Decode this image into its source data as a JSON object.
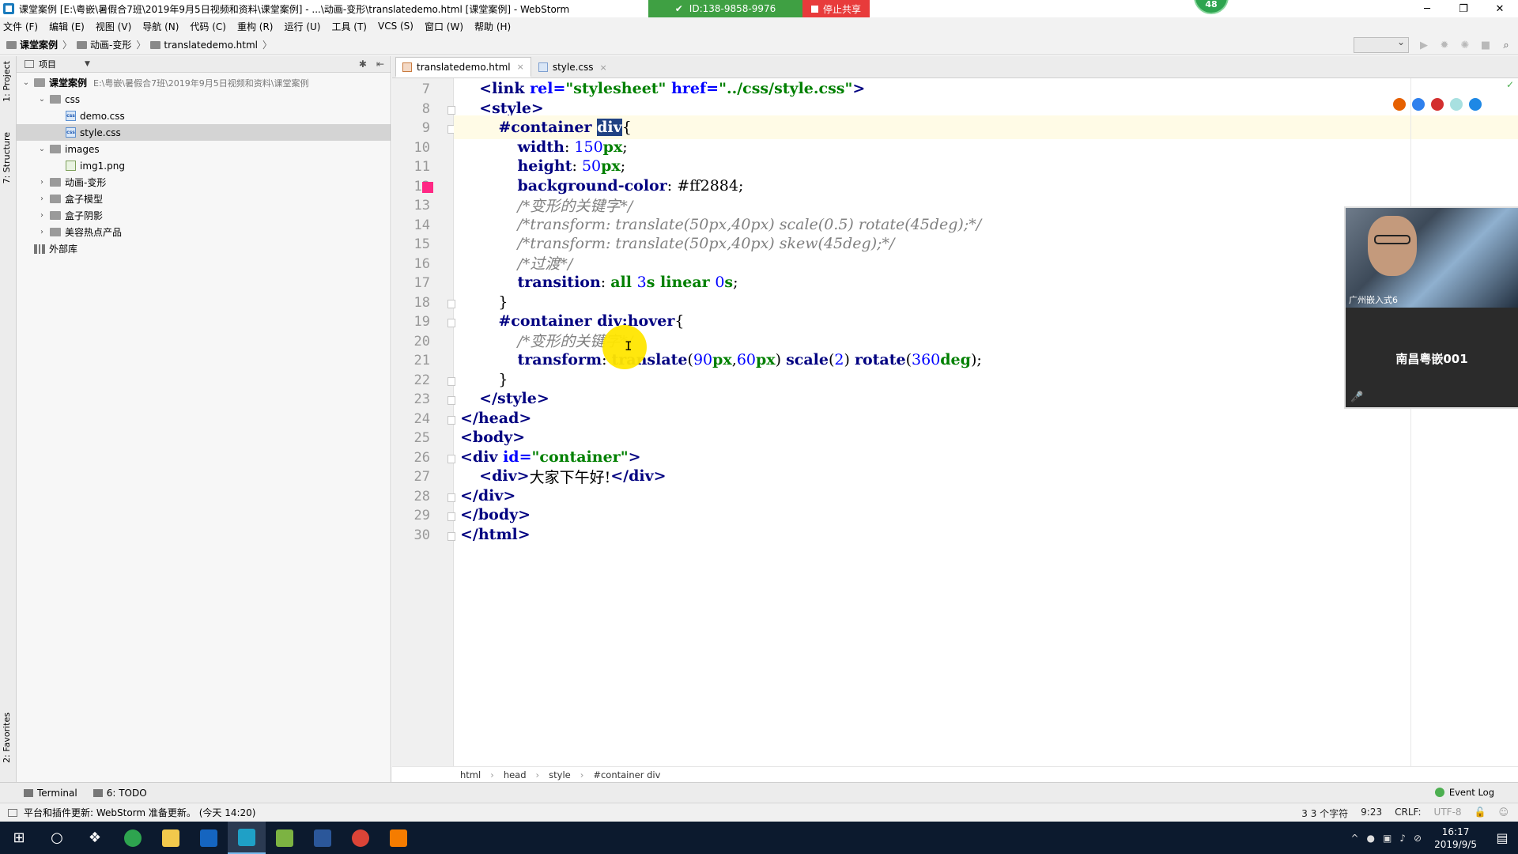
{
  "window": {
    "title": "课堂案例 [E:\\粤嵌\\暑假合7班\\2019年9月5日视频和资料\\课堂案例] - ...\\动画-变形\\translatedemo.html [课堂案例] - WebStorm",
    "controls": {
      "minimize": "─",
      "restore": "❐",
      "close": "✕"
    }
  },
  "share": {
    "id_text": "ID:138-9858-9976",
    "stop_text": "停止共享",
    "badge": "48"
  },
  "menu": [
    "文件 (F)",
    "编辑 (E)",
    "视图 (V)",
    "导航 (N)",
    "代码 (C)",
    "重构 (R)",
    "运行 (U)",
    "工具 (T)",
    "VCS (S)",
    "窗口 (W)",
    "帮助 (H)"
  ],
  "breadcrumb": [
    "课堂案例",
    "动画-变形",
    "translatedemo.html"
  ],
  "left_strip": {
    "project_tab": "1: Project",
    "structure_tab": "7: Structure",
    "favorites_tab": "2: Favorites"
  },
  "project_panel": {
    "header": "项目",
    "tree": [
      {
        "label": "课堂案例",
        "path": "E:\\粤嵌\\暑假合7班\\2019年9月5日视频和资料\\课堂案例",
        "type": "folder",
        "depth": 0,
        "expanded": true,
        "bold": true
      },
      {
        "label": "css",
        "type": "folder",
        "depth": 1,
        "expanded": true
      },
      {
        "label": "demo.css",
        "type": "css",
        "depth": 2
      },
      {
        "label": "style.css",
        "type": "css",
        "depth": 2,
        "selected": true
      },
      {
        "label": "images",
        "type": "folder",
        "depth": 1,
        "expanded": true
      },
      {
        "label": "img1.png",
        "type": "img",
        "depth": 2
      },
      {
        "label": "动画-变形",
        "type": "folder",
        "depth": 1,
        "expanded": false
      },
      {
        "label": "盒子模型",
        "type": "folder",
        "depth": 1,
        "expanded": false
      },
      {
        "label": "盒子阴影",
        "type": "folder",
        "depth": 1,
        "expanded": false
      },
      {
        "label": "美容热点产品",
        "type": "folder",
        "depth": 1,
        "expanded": false
      },
      {
        "label": "外部库",
        "type": "lib",
        "depth": 0
      }
    ]
  },
  "tabs": [
    {
      "label": "translatedemo.html",
      "active": true,
      "kind": "html"
    },
    {
      "label": "style.css",
      "active": false,
      "kind": "css"
    }
  ],
  "code_lines": [
    {
      "n": "7",
      "tokens": [
        [
          "    ",
          "tx"
        ],
        [
          "<link ",
          "tg"
        ],
        [
          "rel=",
          "an"
        ],
        [
          "\"stylesheet\"",
          "av"
        ],
        [
          " href=",
          "an"
        ],
        [
          "\"../css/style.css\"",
          "av"
        ],
        [
          ">",
          "tg"
        ]
      ]
    },
    {
      "n": "8",
      "tokens": [
        [
          "    ",
          "tx"
        ],
        [
          "<style>",
          "tg"
        ]
      ]
    },
    {
      "n": "9",
      "tokens": [
        [
          "        ",
          "tx"
        ],
        [
          "#container ",
          "sel"
        ],
        [
          "div",
          "hl-sel"
        ],
        [
          "{",
          "br"
        ]
      ],
      "current": true
    },
    {
      "n": "10",
      "tokens": [
        [
          "            ",
          "tx"
        ],
        [
          "width",
          "pn"
        ],
        [
          ": ",
          "tx"
        ],
        [
          "150",
          "num"
        ],
        [
          "px",
          "kw"
        ],
        [
          ";",
          "tx"
        ]
      ]
    },
    {
      "n": "11",
      "tokens": [
        [
          "            ",
          "tx"
        ],
        [
          "height",
          "pn"
        ],
        [
          ": ",
          "tx"
        ],
        [
          "50",
          "num"
        ],
        [
          "px",
          "kw"
        ],
        [
          ";",
          "tx"
        ]
      ]
    },
    {
      "n": "12",
      "tokens": [
        [
          "            ",
          "tx"
        ],
        [
          "background-color",
          "pn"
        ],
        [
          ": ",
          "tx"
        ],
        [
          "#ff2884",
          "tx"
        ],
        [
          ";",
          "tx"
        ]
      ],
      "swatch": true
    },
    {
      "n": "13",
      "tokens": [
        [
          "            ",
          "tx"
        ],
        [
          "/*变形的关键字*/",
          "cm"
        ]
      ]
    },
    {
      "n": "14",
      "tokens": [
        [
          "            ",
          "tx"
        ],
        [
          "/*transform: translate(50px,40px) scale(0.5) rotate(45deg);*/",
          "cm"
        ]
      ]
    },
    {
      "n": "15",
      "tokens": [
        [
          "            ",
          "tx"
        ],
        [
          "/*transform: translate(50px,40px) skew(45deg);*/",
          "cm"
        ]
      ]
    },
    {
      "n": "16",
      "tokens": [
        [
          "            ",
          "tx"
        ],
        [
          "/*过渡*/",
          "cm"
        ]
      ]
    },
    {
      "n": "17",
      "tokens": [
        [
          "            ",
          "tx"
        ],
        [
          "transition",
          "pn"
        ],
        [
          ": ",
          "tx"
        ],
        [
          "all ",
          "kw"
        ],
        [
          "3",
          "num"
        ],
        [
          "s ",
          "kw"
        ],
        [
          "linear ",
          "kw"
        ],
        [
          "0",
          "num"
        ],
        [
          "s",
          "kw"
        ],
        [
          ";",
          "tx"
        ]
      ]
    },
    {
      "n": "18",
      "tokens": [
        [
          "        ",
          "tx"
        ],
        [
          "}",
          "br"
        ]
      ]
    },
    {
      "n": "19",
      "tokens": [
        [
          "        ",
          "tx"
        ],
        [
          "#container div",
          "sel"
        ],
        [
          ":hover",
          "sel"
        ],
        [
          "{",
          "br"
        ]
      ]
    },
    {
      "n": "20",
      "tokens": [
        [
          "            ",
          "tx"
        ],
        [
          "/*变形的关键字*/",
          "cm"
        ]
      ]
    },
    {
      "n": "21",
      "tokens": [
        [
          "            ",
          "tx"
        ],
        [
          "transform",
          "pn"
        ],
        [
          ": ",
          "tx"
        ],
        [
          "translate",
          "pn"
        ],
        [
          "(",
          "tx"
        ],
        [
          "90",
          "num"
        ],
        [
          "px",
          "kw"
        ],
        [
          ",",
          "tx"
        ],
        [
          "60",
          "num"
        ],
        [
          "px",
          "kw"
        ],
        [
          ") ",
          "tx"
        ],
        [
          "scale",
          "pn"
        ],
        [
          "(",
          "tx"
        ],
        [
          "2",
          "num"
        ],
        [
          ") ",
          "tx"
        ],
        [
          "rotate",
          "pn"
        ],
        [
          "(",
          "tx"
        ],
        [
          "360",
          "num"
        ],
        [
          "deg",
          "kw"
        ],
        [
          ");",
          "tx"
        ]
      ]
    },
    {
      "n": "22",
      "tokens": [
        [
          "        ",
          "tx"
        ],
        [
          "}",
          "br"
        ]
      ]
    },
    {
      "n": "23",
      "tokens": [
        [
          "    ",
          "tx"
        ],
        [
          "</style>",
          "tg"
        ]
      ]
    },
    {
      "n": "24",
      "tokens": [
        [
          "</head>",
          "tg"
        ]
      ]
    },
    {
      "n": "25",
      "tokens": [
        [
          "<body>",
          "tg"
        ]
      ]
    },
    {
      "n": "26",
      "tokens": [
        [
          "<div ",
          "tg"
        ],
        [
          "id=",
          "an"
        ],
        [
          "\"container\"",
          "av"
        ],
        [
          ">",
          "tg"
        ]
      ]
    },
    {
      "n": "27",
      "tokens": [
        [
          "    ",
          "tx"
        ],
        [
          "<div>",
          "tg"
        ],
        [
          "大家下午好!",
          "tx"
        ],
        [
          "</div>",
          "tg"
        ]
      ]
    },
    {
      "n": "28",
      "tokens": [
        [
          "</div>",
          "tg"
        ]
      ]
    },
    {
      "n": "29",
      "tokens": [
        [
          "</body>",
          "tg"
        ]
      ]
    },
    {
      "n": "30",
      "tokens": [
        [
          "</html>",
          "tg"
        ]
      ]
    }
  ],
  "webcam": {
    "caption": "广州嵌入式6",
    "presenter": "南昌粤嵌001"
  },
  "path_bar": [
    "html",
    "head",
    "style",
    "#container div"
  ],
  "bottom_tools": {
    "terminal": "Terminal",
    "todo": "6: TODO",
    "event_log": "Event Log"
  },
  "status": {
    "message": "平台和插件更新: WebStorm 准备更新。 (今天 14:20)",
    "chars": "3 3 个字符",
    "position": "9:23",
    "line_sep": "CRLF:",
    "encoding": "UTF-8"
  },
  "taskbar": {
    "time": "16:17",
    "date": "2019/9/5"
  },
  "colors": {
    "swatch": "#ff2884",
    "share_green": "#3fa043",
    "share_red": "#e83b3b"
  }
}
